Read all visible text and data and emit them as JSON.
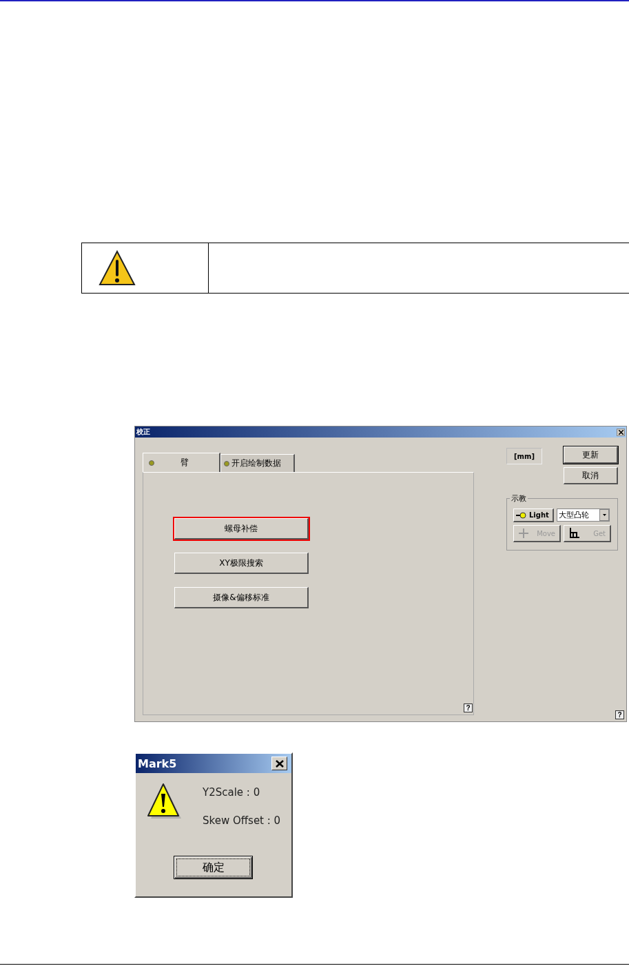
{
  "calibration_dialog": {
    "title": "校正",
    "tabs": [
      {
        "label": "臂",
        "selected": true
      },
      {
        "label": "开启绘制数据",
        "selected": false
      }
    ],
    "actions": [
      {
        "label": "螺母补偿",
        "highlighted": true
      },
      {
        "label": "XY极限搜索",
        "highlighted": false
      },
      {
        "label": "摄像&偏移标准",
        "highlighted": false
      }
    ],
    "panel_help": "?",
    "unit": "[mm]",
    "buttons": [
      {
        "label": "更新",
        "default": true
      },
      {
        "label": "取消",
        "default": false
      }
    ],
    "teach_group": {
      "title": "示教",
      "light_button": "Light",
      "mode_select": "大型凸轮",
      "move_button": {
        "label": "Move",
        "disabled": true
      },
      "get_button": {
        "label": "Get",
        "disabled": true
      }
    },
    "window_help": "?"
  },
  "message_box": {
    "title": "Mark5",
    "lines": [
      "Y2Scale : 0",
      "Skew Offset : 0"
    ],
    "ok_button": "确定"
  }
}
